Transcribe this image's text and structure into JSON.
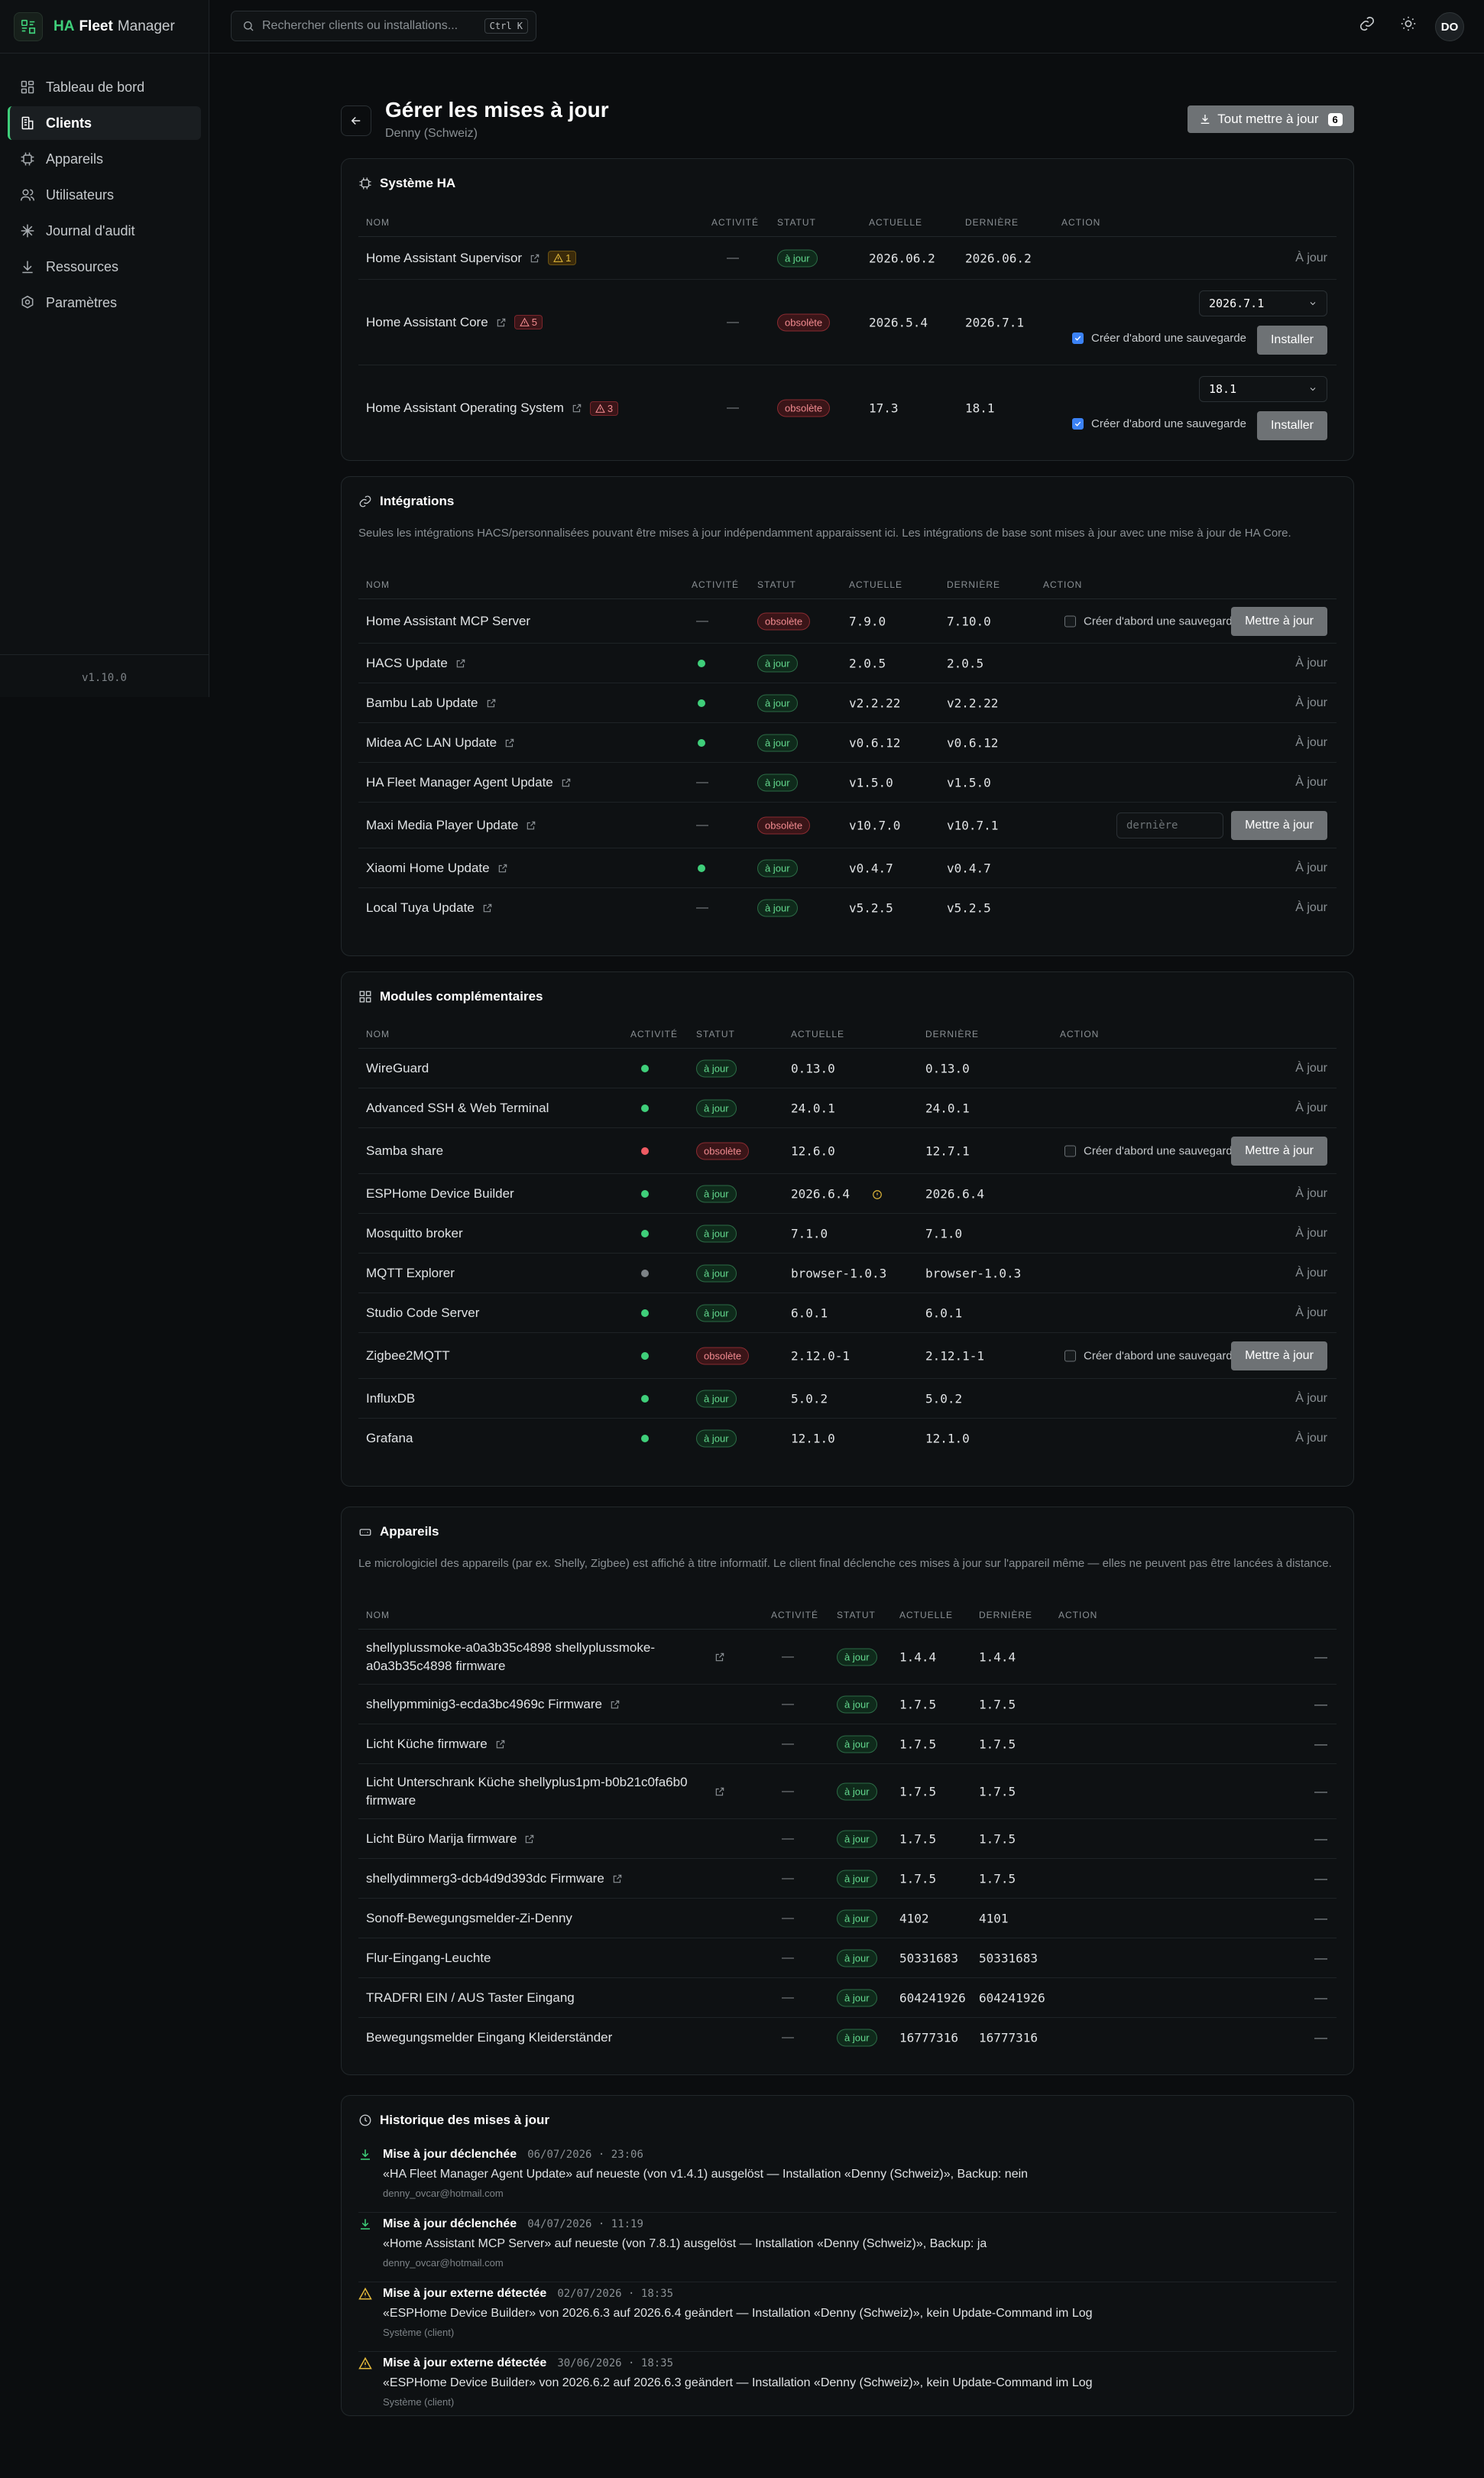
{
  "brand": {
    "part1": "HA",
    "part2": "Fleet",
    "part3": "Manager"
  },
  "nav": [
    {
      "label": "Tableau de bord",
      "icon": "dashboard-icon"
    },
    {
      "label": "Clients",
      "icon": "building-icon",
      "active": true
    },
    {
      "label": "Appareils",
      "icon": "chip-icon"
    },
    {
      "label": "Utilisateurs",
      "icon": "users-icon"
    },
    {
      "label": "Journal d'audit",
      "icon": "activity-icon"
    },
    {
      "label": "Ressources",
      "icon": "download-icon"
    },
    {
      "label": "Paramètres",
      "icon": "settings-icon"
    }
  ],
  "version": "v1.10.0",
  "search": {
    "placeholder": "Rechercher clients ou installations...",
    "shortcut": "Ctrl K"
  },
  "user_initials": "DO",
  "page": {
    "title": "Gérer les mises à jour",
    "subtitle": "Denny (Schweiz)",
    "update_all_label": "Tout mettre à jour",
    "update_all_count": "6"
  },
  "labels": {
    "col_name": "NOM",
    "col_activity": "ACTIVITÉ",
    "col_status": "STATUT",
    "col_current": "ACTUELLE",
    "col_latest": "DERNIÈRE",
    "col_action": "ACTION",
    "up_to_date": "À jour",
    "backup_first": "Créer d'abord une sauvegarde",
    "install": "Installer",
    "update": "Mettre à jour",
    "badge_ok": "à jour",
    "badge_bad": "obsolète",
    "dash": "—",
    "latest_placeholder": "dernière"
  },
  "system": {
    "title": "Système HA",
    "rows": [
      {
        "name": "Home Assistant Supervisor",
        "warn": "1",
        "current": "2026.06.2",
        "latest": "2026.06.2"
      },
      {
        "name": "Home Assistant Core",
        "warn": "5",
        "current": "2026.5.4",
        "latest": "2026.7.1",
        "select": "2026.7.1"
      },
      {
        "name": "Home Assistant Operating System",
        "warn": "3",
        "current": "17.3",
        "latest": "18.1",
        "select": "18.1"
      }
    ]
  },
  "integrations": {
    "title": "Intégrations",
    "desc": "Seules les intégrations HACS/personnalisées pouvant être mises à jour indépendamment apparaissent ici. Les intégrations de base sont mises à jour avec une mise à jour de HA Core.",
    "rows": [
      {
        "name": "Home Assistant MCP Server",
        "current": "7.9.0",
        "latest": "7.10.0"
      },
      {
        "name": "HACS Update",
        "current": "2.0.5",
        "latest": "2.0.5"
      },
      {
        "name": "Bambu Lab Update",
        "current": "v2.2.22",
        "latest": "v2.2.22"
      },
      {
        "name": "Midea AC LAN Update",
        "current": "v0.6.12",
        "latest": "v0.6.12"
      },
      {
        "name": "HA Fleet Manager Agent Update",
        "current": "v1.5.0",
        "latest": "v1.5.0"
      },
      {
        "name": "Maxi Media Player Update",
        "current": "v10.7.0",
        "latest": "v10.7.1"
      },
      {
        "name": "Xiaomi Home Update",
        "current": "v0.4.7",
        "latest": "v0.4.7"
      },
      {
        "name": "Local Tuya Update",
        "current": "v5.2.5",
        "latest": "v5.2.5"
      }
    ]
  },
  "addons": {
    "title": "Modules complémentaires",
    "rows": [
      {
        "name": "WireGuard",
        "current": "0.13.0",
        "latest": "0.13.0"
      },
      {
        "name": "Advanced SSH & Web Terminal",
        "current": "24.0.1",
        "latest": "24.0.1"
      },
      {
        "name": "Samba share",
        "current": "12.6.0",
        "latest": "12.7.1"
      },
      {
        "name": "ESPHome Device Builder",
        "current": "2026.6.4",
        "latest": "2026.6.4"
      },
      {
        "name": "Mosquitto broker",
        "current": "7.1.0",
        "latest": "7.1.0"
      },
      {
        "name": "MQTT Explorer",
        "current": "browser-1.0.3",
        "latest": "browser-1.0.3"
      },
      {
        "name": "Studio Code Server",
        "current": "6.0.1",
        "latest": "6.0.1"
      },
      {
        "name": "Zigbee2MQTT",
        "current": "2.12.0-1",
        "latest": "2.12.1-1"
      },
      {
        "name": "InfluxDB",
        "current": "5.0.2",
        "latest": "5.0.2"
      },
      {
        "name": "Grafana",
        "current": "12.1.0",
        "latest": "12.1.0"
      }
    ]
  },
  "devices": {
    "title": "Appareils",
    "desc": "Le micrologiciel des appareils (par ex. Shelly, Zigbee) est affiché à titre informatif. Le client final déclenche ces mises à jour sur l'appareil même — elles ne peuvent pas être lancées à distance.",
    "rows": [
      {
        "name": "shellyplussmoke-a0a3b35c4898 shellyplussmoke-a0a3b35c4898 firmware",
        "current": "1.4.4",
        "latest": "1.4.4"
      },
      {
        "name": "shellypmminig3-ecda3bc4969c Firmware",
        "current": "1.7.5",
        "latest": "1.7.5"
      },
      {
        "name": "Licht Küche firmware",
        "current": "1.7.5",
        "latest": "1.7.5"
      },
      {
        "name": "Licht Unterschrank Küche shellyplus1pm-b0b21c0fa6b0 firmware",
        "current": "1.7.5",
        "latest": "1.7.5"
      },
      {
        "name": "Licht Büro Marija firmware",
        "current": "1.7.5",
        "latest": "1.7.5"
      },
      {
        "name": "shellydimmerg3-dcb4d9d393dc Firmware",
        "current": "1.7.5",
        "latest": "1.7.5"
      },
      {
        "name": "Sonoff-Bewegungsmelder-Zi-Denny",
        "current": "4102",
        "latest": "4101"
      },
      {
        "name": "Flur-Eingang-Leuchte",
        "current": "50331683",
        "latest": "50331683"
      },
      {
        "name": "TRADFRI EIN / AUS Taster Eingang",
        "current": "604241926",
        "latest": "604241926"
      },
      {
        "name": "Bewegungsmelder Eingang Kleiderständer",
        "current": "16777316",
        "latest": "16777316"
      }
    ]
  },
  "history": {
    "title": "Historique des mises à jour",
    "items": [
      {
        "head": "Mise à jour déclenchée",
        "ts": "06/07/2026 · 23:06",
        "text": "«HA Fleet Manager Agent Update» auf neueste (von v1.4.1) ausgelöst — Installation «Denny (Schweiz)», Backup: nein",
        "user": "denny_ovcar@hotmail.com"
      },
      {
        "head": "Mise à jour déclenchée",
        "ts": "04/07/2026 · 11:19",
        "text": "«Home Assistant MCP Server» auf neueste (von 7.8.1) ausgelöst — Installation «Denny (Schweiz)», Backup: ja",
        "user": "denny_ovcar@hotmail.com"
      },
      {
        "head": "Mise à jour externe détectée",
        "ts": "02/07/2026 · 18:35",
        "text": "«ESPHome Device Builder» von 2026.6.3 auf 2026.6.4 geändert — Installation «Denny (Schweiz)», kein Update-Command im Log",
        "user": "Système (client)"
      },
      {
        "head": "Mise à jour externe détectée",
        "ts": "30/06/2026 · 18:35",
        "text": "«ESPHome Device Builder» von 2026.6.2 auf 2026.6.3 geändert — Installation «Denny (Schweiz)», kein Update-Command im Log",
        "user": "Système (client)"
      }
    ]
  },
  "colors": {
    "accent": "#3fcf7a",
    "danger": "#ef5b63",
    "warning": "#e2b93b",
    "muted_dot": "#7d8387"
  }
}
